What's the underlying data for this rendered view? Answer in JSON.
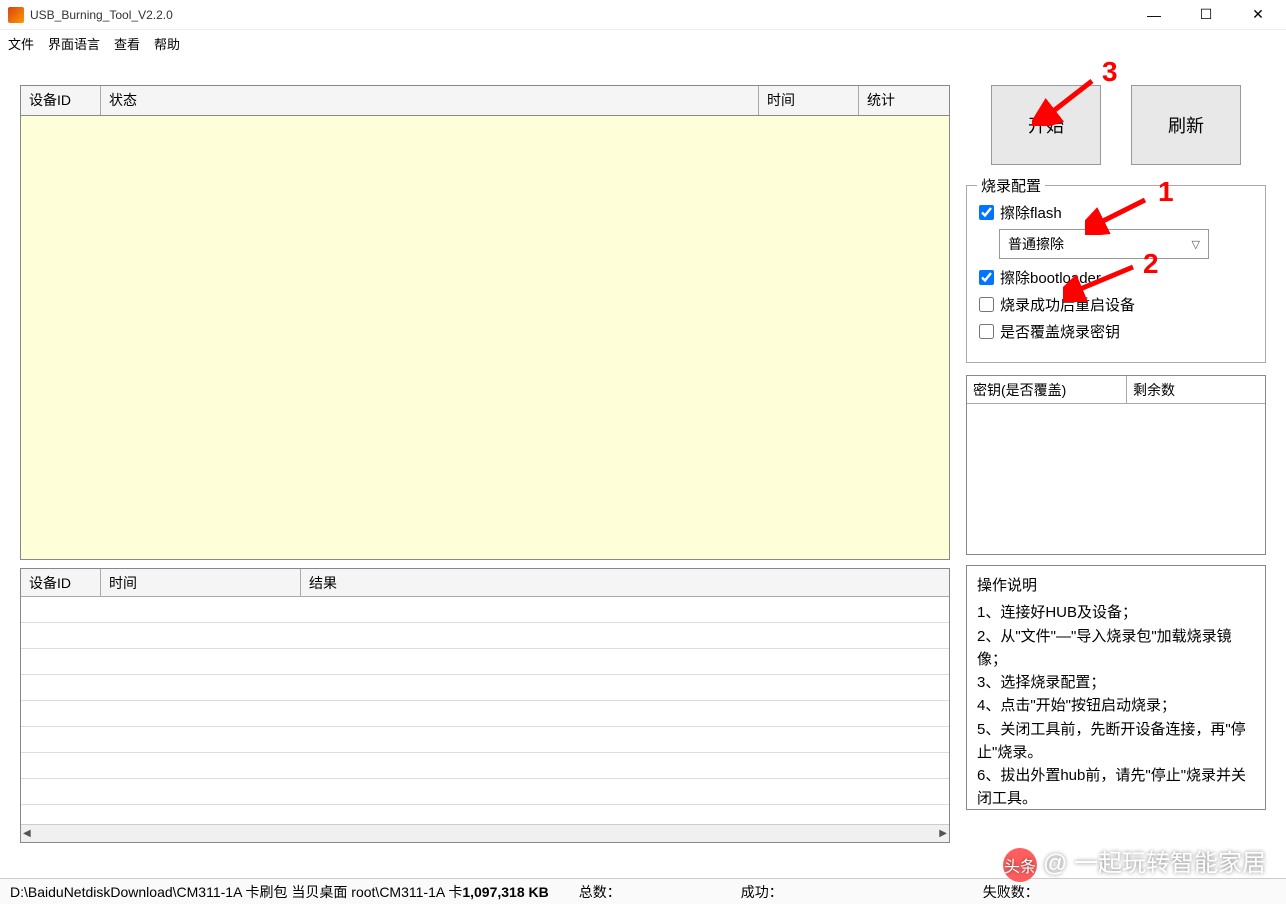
{
  "window": {
    "title": "USB_Burning_Tool_V2.2.0"
  },
  "menu": {
    "file": "文件",
    "language": "界面语言",
    "view": "查看",
    "help": "帮助"
  },
  "table1": {
    "devid": "设备ID",
    "status": "状态",
    "time": "时间",
    "stat": "统计"
  },
  "table2": {
    "devid": "设备ID",
    "time": "时间",
    "result": "结果"
  },
  "buttons": {
    "start": "开始",
    "refresh": "刷新"
  },
  "config": {
    "title": "烧录配置",
    "erase_flash": "擦除flash",
    "erase_mode": "普通擦除",
    "erase_bootloader": "擦除bootloader",
    "reboot_after": "烧录成功后重启设备",
    "overwrite_key": "是否覆盖烧录密钥"
  },
  "keytable": {
    "col1": "密钥(是否覆盖)",
    "col2": "剩余数"
  },
  "instructions": {
    "title": "操作说明",
    "line1": "1、连接好HUB及设备；",
    "line2": "2、从\"文件\"—\"导入烧录包\"加载烧录镜像；",
    "line3": "3、选择烧录配置；",
    "line4": "4、点击\"开始\"按钮启动烧录；",
    "line5": "5、关闭工具前，先断开设备连接，再\"停止\"烧录。",
    "line6": "6、拔出外置hub前，请先\"停止\"烧录并关闭工具。"
  },
  "status": {
    "path_prefix": "D:\\BaiduNetdiskDownload\\CM311-1A 卡刷包 当贝桌面 root\\CM311-1A 卡",
    "size": "1,097,318 KB",
    "total": "总数：",
    "success": "成功：",
    "fail": "失败数："
  },
  "annotations": {
    "n1": "1",
    "n2": "2",
    "n3": "3"
  },
  "watermark": {
    "logo": "头条",
    "text": "@ 一起玩转智能家居"
  }
}
